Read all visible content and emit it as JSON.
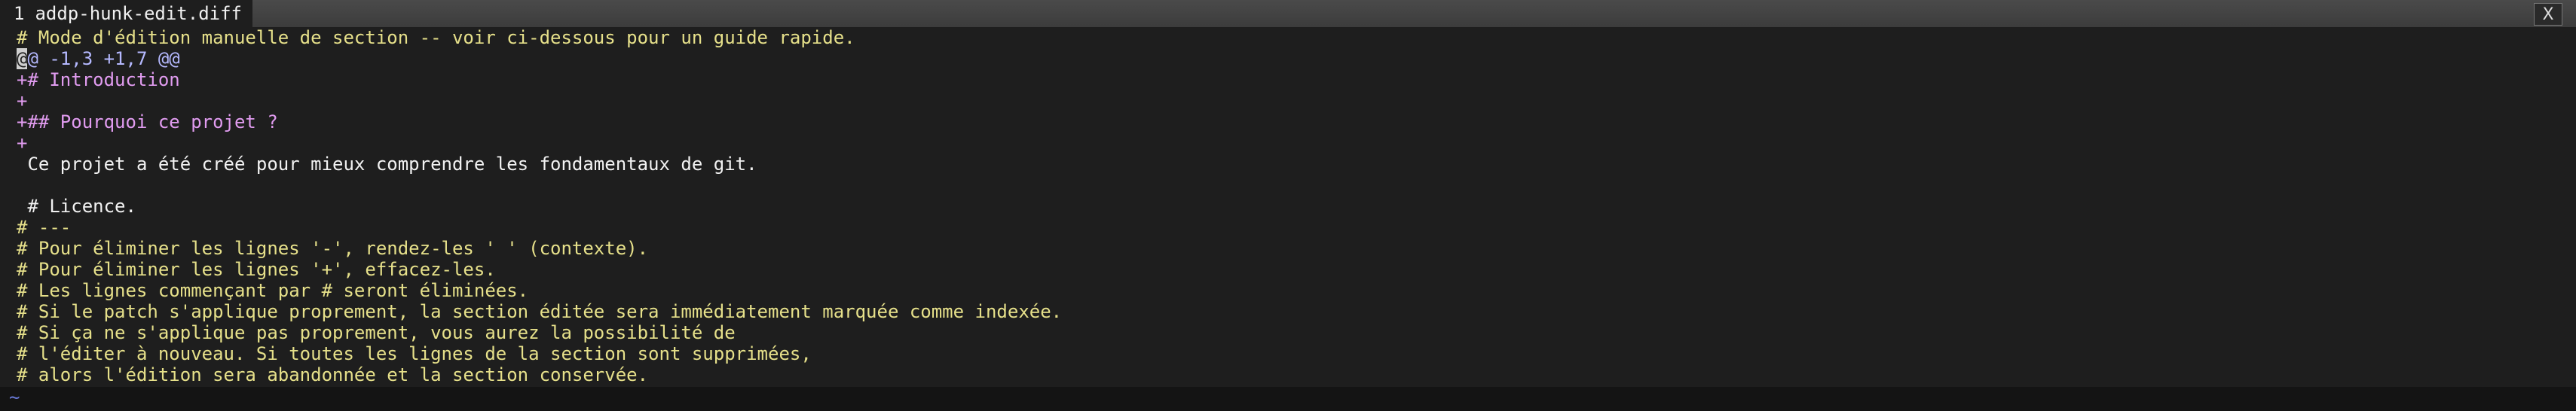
{
  "tab": {
    "number": "1",
    "filename": "addp-hunk-edit.diff",
    "close_label": "X"
  },
  "lines": [
    {
      "kind": "comment",
      "text": "# Mode d'édition manuelle de section -- voir ci-dessous pour un guide rapide."
    },
    {
      "kind": "hunk",
      "cursor": "@",
      "text": "@ -1,3 +1,7 @@"
    },
    {
      "kind": "add",
      "text": "+# Introduction"
    },
    {
      "kind": "add",
      "text": "+"
    },
    {
      "kind": "add",
      "text": "+## Pourquoi ce projet ?"
    },
    {
      "kind": "add",
      "text": "+"
    },
    {
      "kind": "ctx",
      "text": " Ce projet a été créé pour mieux comprendre les fondamentaux de git."
    },
    {
      "kind": "ctx",
      "text": " "
    },
    {
      "kind": "ctx",
      "text": " # Licence."
    },
    {
      "kind": "comment",
      "text": "# ---"
    },
    {
      "kind": "comment",
      "text": "# Pour éliminer les lignes '-', rendez-les ' ' (contexte)."
    },
    {
      "kind": "comment",
      "text": "# Pour éliminer les lignes '+', effacez-les."
    },
    {
      "kind": "comment",
      "text": "# Les lignes commençant par # seront éliminées."
    },
    {
      "kind": "comment",
      "text": "# Si le patch s'applique proprement, la section éditée sera immédiatement marquée comme indexée."
    },
    {
      "kind": "comment",
      "text": "# Si ça ne s'applique pas proprement, vous aurez la possibilité de"
    },
    {
      "kind": "comment",
      "text": "# l'éditer à nouveau. Si toutes les lignes de la section sont supprimées,"
    },
    {
      "kind": "comment",
      "text": "# alors l'édition sera abandonnée et la section conservée."
    }
  ],
  "empty_line_marker": "~",
  "colors": {
    "background": "#1e1e1e",
    "comment": "#e6e08a",
    "hunk_header": "#b5b9ff",
    "added": "#e19cf0",
    "context": "#f2f2f2",
    "empty_marker": "#6a7ad8"
  }
}
